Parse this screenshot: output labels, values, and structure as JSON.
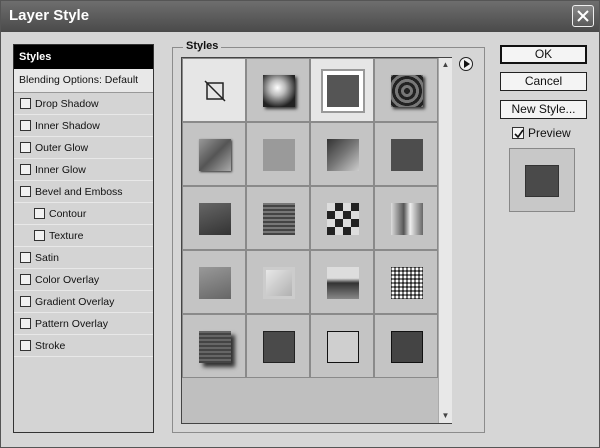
{
  "window": {
    "title": "Layer Style"
  },
  "styles_list": {
    "header": "Styles",
    "blending": "Blending Options: Default",
    "items": [
      {
        "label": "Drop Shadow",
        "sub": false
      },
      {
        "label": "Inner Shadow",
        "sub": false
      },
      {
        "label": "Outer Glow",
        "sub": false
      },
      {
        "label": "Inner Glow",
        "sub": false
      },
      {
        "label": "Bevel and Emboss",
        "sub": false
      },
      {
        "label": "Contour",
        "sub": true
      },
      {
        "label": "Texture",
        "sub": true
      },
      {
        "label": "Satin",
        "sub": false
      },
      {
        "label": "Color Overlay",
        "sub": false
      },
      {
        "label": "Gradient Overlay",
        "sub": false
      },
      {
        "label": "Pattern Overlay",
        "sub": false
      },
      {
        "label": "Stroke",
        "sub": false
      }
    ]
  },
  "styles_panel": {
    "legend": "Styles",
    "swatches": [
      "none",
      "glow",
      "outline-glow",
      "rings",
      "emboss",
      "flat-light",
      "dark-grad",
      "flat-dark",
      "dark-bevel",
      "grid",
      "checker",
      "mirror",
      "soft-grad",
      "light-bevel",
      "horizon",
      "speckle",
      "dark-drop",
      "dark-square",
      "outline",
      "dark-border"
    ]
  },
  "buttons": {
    "ok": "OK",
    "cancel": "Cancel",
    "new_style": "New Style...",
    "preview": "Preview"
  }
}
